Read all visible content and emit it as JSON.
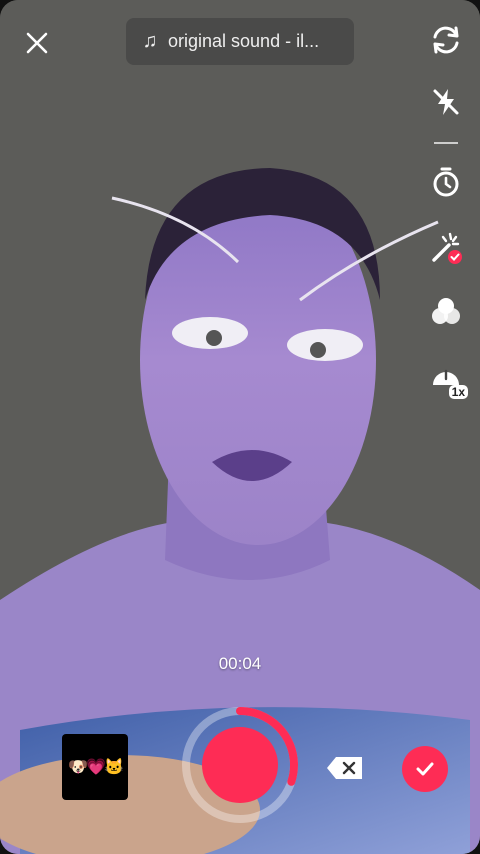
{
  "top_bar": {
    "sound_label": "original sound - il...",
    "sound_icon": "music-note-icon",
    "close_icon": "close-icon"
  },
  "tools": [
    {
      "name": "flip-camera",
      "icon": "flip-camera-icon"
    },
    {
      "name": "flash-off",
      "icon": "flash-off-icon"
    },
    {
      "name": "timer",
      "icon": "timer-icon"
    },
    {
      "name": "beauty",
      "icon": "magic-wand-icon",
      "badge": "checkmark"
    },
    {
      "name": "filters",
      "icon": "filters-icon"
    },
    {
      "name": "speed",
      "icon": "speed-icon",
      "label": "1x"
    }
  ],
  "recording": {
    "elapsed": "00:04",
    "progress": 0.3
  },
  "effect_thumbnail": {
    "glyphs": "🐶💗🐱"
  },
  "colors": {
    "accent": "#fe2c55",
    "pill_bg": "#3c3c3c"
  }
}
